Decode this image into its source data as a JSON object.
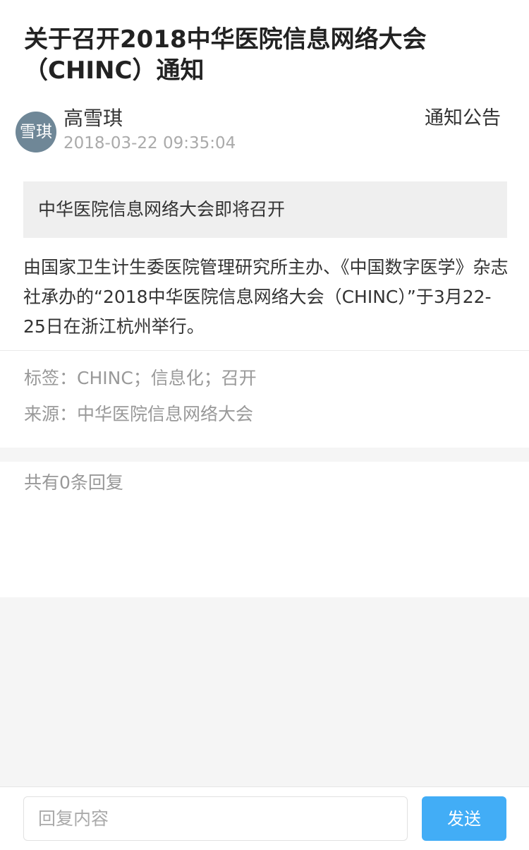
{
  "article": {
    "title": "关于召开2018中华医院信息网络大会（CHINC）通知",
    "avatar_text": "雪琪",
    "author": "高雪琪",
    "date": "2018-03-22 09:35:04",
    "category": "通知公告",
    "summary": "中华医院信息网络大会即将召开",
    "body": "由国家卫生计生委医院管理研究所主办、《中国数字医学》杂志社承办的“2018中华医院信息网络大会（CHINC）”于3月22-25日在浙江杭州举行。"
  },
  "meta": {
    "tags_label": "标签：",
    "tags_value": "CHINC；信息化；召开",
    "source_label": "来源：",
    "source_value": "中华医院信息网络大会"
  },
  "replies": {
    "count_text": "共有0条回复"
  },
  "reply_bar": {
    "placeholder": "回复内容",
    "send_label": "发送"
  },
  "colors": {
    "accent": "#42adf6",
    "avatar_background": "#6f8797",
    "page_background": "#f5f5f5"
  },
  "icons": {
    "avatar": "text-avatar"
  }
}
